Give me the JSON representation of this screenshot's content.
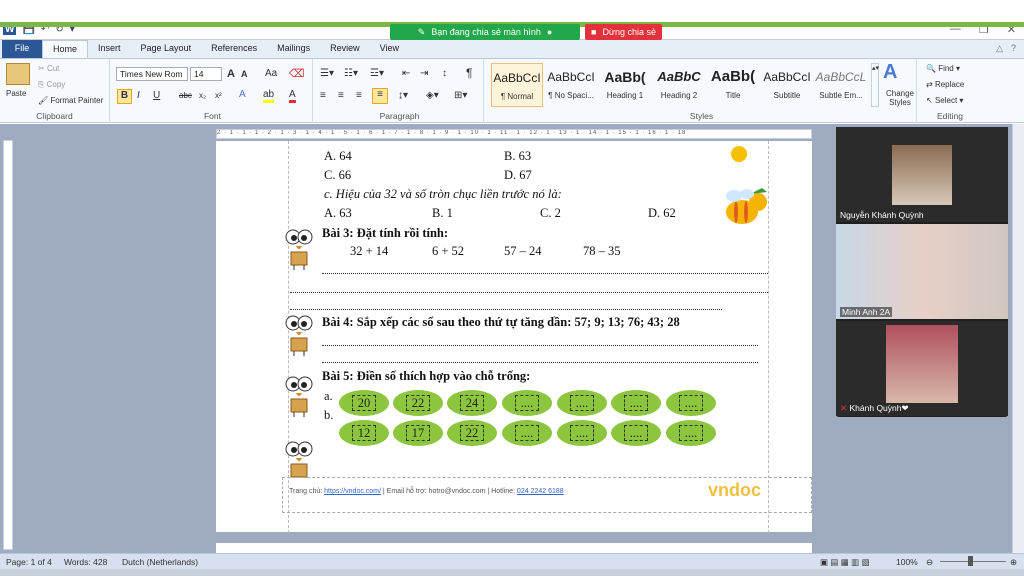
{
  "sharing": {
    "message": "Bạn đang chia sẻ màn hình",
    "stop": "Dừng chia sẻ"
  },
  "titlebar": {
    "win_min": "—",
    "win_restore": "❐",
    "win_close": "✕"
  },
  "tabs": [
    "File",
    "Home",
    "Insert",
    "Page Layout",
    "References",
    "Mailings",
    "Review",
    "View"
  ],
  "active_tab": "Home",
  "clipboard": {
    "paste": "Paste",
    "cut": "Cut",
    "copy": "Copy",
    "format_painter": "Format Painter",
    "label": "Clipboard"
  },
  "font": {
    "name": "Times New Rom",
    "size": "14",
    "grow": "A",
    "shrink": "A",
    "change_case": "Aa",
    "bold": "B",
    "italic": "I",
    "underline": "U",
    "strike": "abc",
    "sub": "x₂",
    "sup": "x²",
    "label": "Font"
  },
  "paragraph": {
    "label": "Paragraph"
  },
  "styles": {
    "items": [
      {
        "preview": "AaBbCcI",
        "name": "¶ Normal"
      },
      {
        "preview": "AaBbCcI",
        "name": "¶ No Spaci..."
      },
      {
        "preview": "AaBb(",
        "name": "Heading 1"
      },
      {
        "preview": "AaBbC",
        "name": "Heading 2"
      },
      {
        "preview": "AaBb(",
        "name": "Title"
      },
      {
        "preview": "AaBbCcI",
        "name": "Subtitle"
      },
      {
        "preview": "AaBbCcL",
        "name": "Subtle Em..."
      }
    ],
    "change_styles": "Change Styles",
    "label": "Styles"
  },
  "editing": {
    "find": "Find",
    "replace": "Replace",
    "select": "Select",
    "label": "Editing"
  },
  "ruler_text": "2 · 1 · 1 · 1 · 2 · 1 · 3 · 1 · 4 · 1 · 5 · 1 · 6 · 1 · 7 · 1 · 8 · 1 · 9 · 1 · 10 · 1 · 11 · 1 · 12 · 1 · 13 · 1 · 14 · 1 · 15 · 1 · 16 · 1 · 18",
  "doc": {
    "opt_a": "A. 64",
    "opt_b": "B. 63",
    "opt_c": "C. 66",
    "opt_d": "D. 67",
    "question_c": "c. Hiệu của 32 và số tròn chục liền trước nó là:",
    "ans_a": "A. 63",
    "ans_b": "B. 1",
    "ans_c": "C. 2",
    "ans_d": "D. 62",
    "bai3": "Bài 3:  Đặt tính rồi tính:",
    "calc": [
      "32 + 14",
      "6 + 52",
      "57 – 24",
      "78 – 35"
    ],
    "bai4": "Bài 4: Sắp xếp các số sau theo thứ tự tăng dần: 57; 9; 13; 76; 43; 28",
    "bai5": "Bài 5: Điền số thích hợp vào chỗ trống:",
    "row_a_label": "a.",
    "row_b_label": "b.",
    "row_a": [
      "20",
      "22",
      "24",
      "....",
      "....",
      "....",
      "...."
    ],
    "row_b": [
      "12",
      "17",
      "22",
      "....",
      "....",
      "....",
      "...."
    ],
    "footer": {
      "home_label": "Trang chủ: ",
      "home_url": "https://vndoc.com/",
      "email": " | Email hỗ trợ: hotro@vndoc.com | Hotline: ",
      "hotline": "024 2242 6188",
      "logo": "vndoc"
    }
  },
  "participants": [
    {
      "name": "Nguyễn Khánh Quỳnh"
    },
    {
      "name": "Minh Anh 2A"
    },
    {
      "name": "Khánh Quỳnh❤"
    }
  ],
  "status": {
    "page": "Page: 1 of 4",
    "words": "Words: 428",
    "language": "Dutch (Netherlands)",
    "zoom": "100%"
  },
  "colors": {
    "share_green": "#22a84a",
    "stop_red": "#e3303a",
    "leaf": "#8cc63f",
    "file_tab": "#2b5797"
  }
}
